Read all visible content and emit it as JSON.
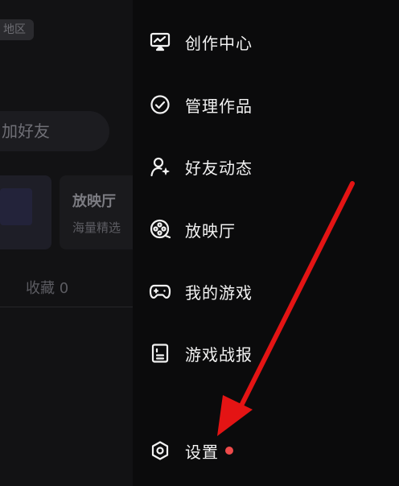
{
  "background_page": {
    "region_badge": "地区",
    "add_friend": "加好友",
    "card_title": "放映厅",
    "card_subtitle": "海量精选",
    "favorites_tab": "收藏 0"
  },
  "menu": {
    "items": [
      {
        "label": "创作中心",
        "icon": "creator-monitor-icon"
      },
      {
        "label": "管理作品",
        "icon": "check-circle-icon"
      },
      {
        "label": "好友动态",
        "icon": "user-sparkle-icon"
      },
      {
        "label": "放映厅",
        "icon": "film-reel-icon"
      },
      {
        "label": "我的游戏",
        "icon": "gamepad-icon"
      },
      {
        "label": "游戏战报",
        "icon": "report-card-icon"
      },
      {
        "label": "设置",
        "icon": "settings-hexagon-icon",
        "badge": "red-dot"
      }
    ]
  },
  "colors": {
    "background": "#0b0b0c",
    "text": "#f2f2f2",
    "badge_dot": "#ef4a4a",
    "annotation_arrow": "#e41414"
  }
}
